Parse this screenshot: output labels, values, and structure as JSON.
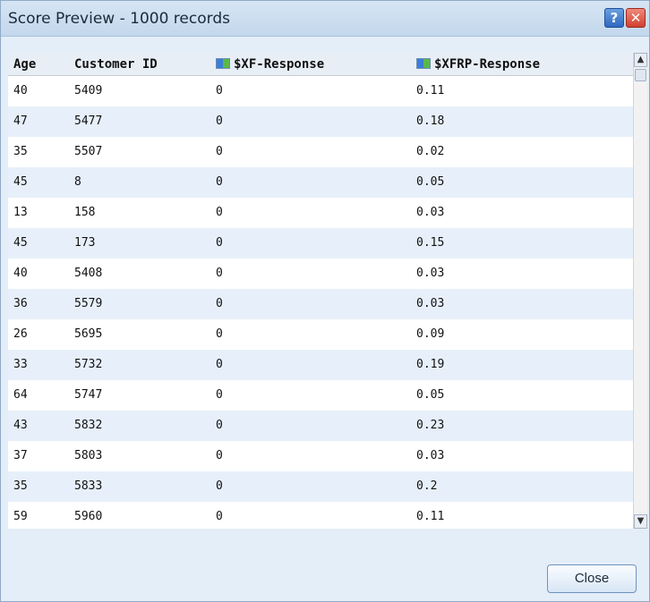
{
  "window": {
    "title": "Score Preview - 1000 records",
    "help_label": "?",
    "close_glyph": "✕"
  },
  "table": {
    "columns": [
      "Age",
      "Customer ID",
      "$XF-Response",
      "$XFRP-Response"
    ],
    "rows": [
      [
        "40",
        "5409",
        "0",
        "0.11"
      ],
      [
        "47",
        "5477",
        "0",
        "0.18"
      ],
      [
        "35",
        "5507",
        "0",
        "0.02"
      ],
      [
        "45",
        "8",
        "0",
        "0.05"
      ],
      [
        "13",
        "158",
        "0",
        "0.03"
      ],
      [
        "45",
        "173",
        "0",
        "0.15"
      ],
      [
        "40",
        "5408",
        "0",
        "0.03"
      ],
      [
        "36",
        "5579",
        "0",
        "0.03"
      ],
      [
        "26",
        "5695",
        "0",
        "0.09"
      ],
      [
        "33",
        "5732",
        "0",
        "0.19"
      ],
      [
        "64",
        "5747",
        "0",
        "0.05"
      ],
      [
        "43",
        "5832",
        "0",
        "0.23"
      ],
      [
        "37",
        "5803",
        "0",
        "0.03"
      ],
      [
        "35",
        "5833",
        "0",
        "0.2"
      ],
      [
        "59",
        "5960",
        "0",
        "0.11"
      ]
    ]
  },
  "scrollbar": {
    "up": "▲",
    "down": "▼"
  },
  "footer": {
    "close_label": "Close"
  }
}
